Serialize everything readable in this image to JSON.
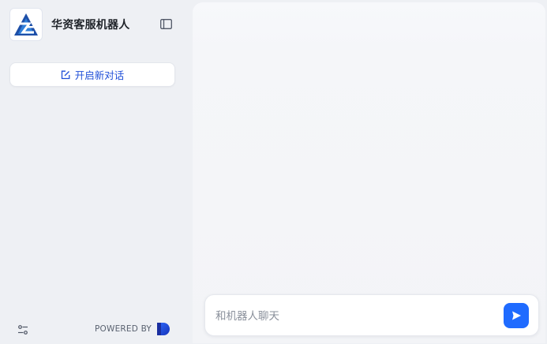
{
  "sidebar": {
    "app_title": "华资客服机器人",
    "new_chat_label": "开启新对话",
    "powered_by_label": "POWERED BY"
  },
  "chat": {
    "input_placeholder": "和机器人聊天",
    "input_value": ""
  },
  "icons": {
    "logo": "brand-logo",
    "collapse": "sidebar-collapse-icon",
    "new_chat": "edit-icon",
    "settings": "sliders-icon",
    "powered_mark": "dify-mark",
    "send": "send-icon"
  },
  "colors": {
    "accent": "#1f6bff",
    "new_chat_text": "#1f4fd8",
    "sidebar_bg": "#eef0f4",
    "main_bg": "#f5f6f9"
  }
}
